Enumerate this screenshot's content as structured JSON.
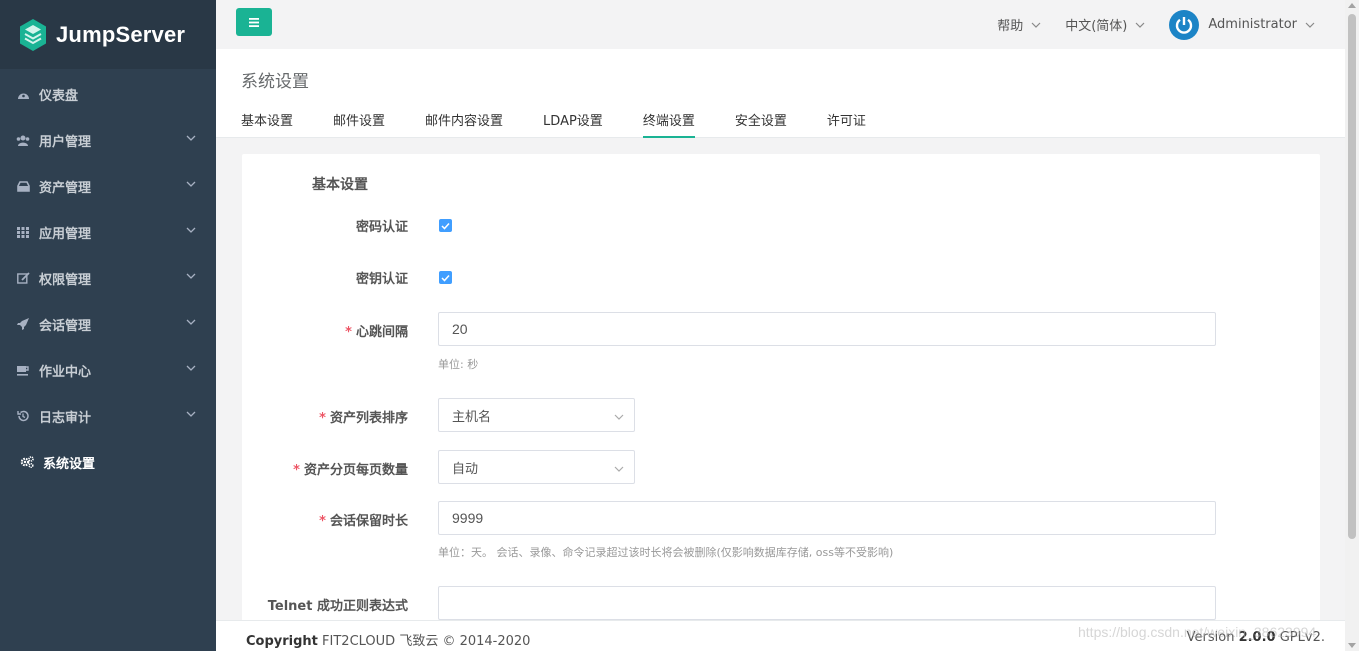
{
  "brand": {
    "name": "JumpServer"
  },
  "colors": {
    "sidebar_bg": "#2f4050",
    "accent": "#1ab394",
    "checkbox": "#409eff",
    "required": "#ed5565",
    "avatar": "#1c84c6"
  },
  "sidebar": {
    "items": [
      {
        "label": "仪表盘",
        "icon": "dashboard-icon",
        "has_children": false
      },
      {
        "label": "用户管理",
        "icon": "users-icon",
        "has_children": true
      },
      {
        "label": "资产管理",
        "icon": "inbox-icon",
        "has_children": true
      },
      {
        "label": "应用管理",
        "icon": "grid-icon",
        "has_children": true
      },
      {
        "label": "权限管理",
        "icon": "edit-icon",
        "has_children": true
      },
      {
        "label": "会话管理",
        "icon": "rocket-icon",
        "has_children": true
      },
      {
        "label": "作业中心",
        "icon": "coffee-icon",
        "has_children": true
      },
      {
        "label": "日志审计",
        "icon": "history-icon",
        "has_children": true
      },
      {
        "label": "系统设置",
        "icon": "gears-icon",
        "has_children": false,
        "active": true
      }
    ]
  },
  "topbar": {
    "help_label": "帮助",
    "language_label": "中文(简体)",
    "user_label": "Administrator"
  },
  "page": {
    "title": "系统设置",
    "tabs": [
      {
        "label": "基本设置"
      },
      {
        "label": "邮件设置"
      },
      {
        "label": "邮件内容设置"
      },
      {
        "label": "LDAP设置"
      },
      {
        "label": "终端设置",
        "active": true
      },
      {
        "label": "安全设置"
      },
      {
        "label": "许可证"
      }
    ]
  },
  "form": {
    "section_title": "基本设置",
    "password_auth": {
      "label": "密码认证",
      "checked": true
    },
    "key_auth": {
      "label": "密钥认证",
      "checked": true
    },
    "heartbeat": {
      "required_mark": "*",
      "label": "心跳间隔",
      "value": "20",
      "help": "单位: 秒"
    },
    "asset_sort": {
      "required_mark": "*",
      "label": "资产列表排序",
      "value": "主机名"
    },
    "asset_page_size": {
      "required_mark": "*",
      "label": "资产分页每页数量",
      "value": "自动"
    },
    "session_keep": {
      "required_mark": "*",
      "label": "会话保留时长",
      "value": "9999",
      "help": "单位：天。 会话、录像、命令记录超过该时长将会被删除(仅影响数据库存储, oss等不受影响)"
    },
    "telnet_regex": {
      "label": "Telnet 成功正则表达式",
      "value": ""
    }
  },
  "footer": {
    "copyright_bold": "Copyright",
    "copyright_text": "FIT2CLOUD 飞致云 © 2014-2020",
    "version_prefix": "Version",
    "version_number": "2.0.0",
    "version_suffix": "GPLv2."
  },
  "watermark": "https://blog.csdn.net/weixin_38623994"
}
